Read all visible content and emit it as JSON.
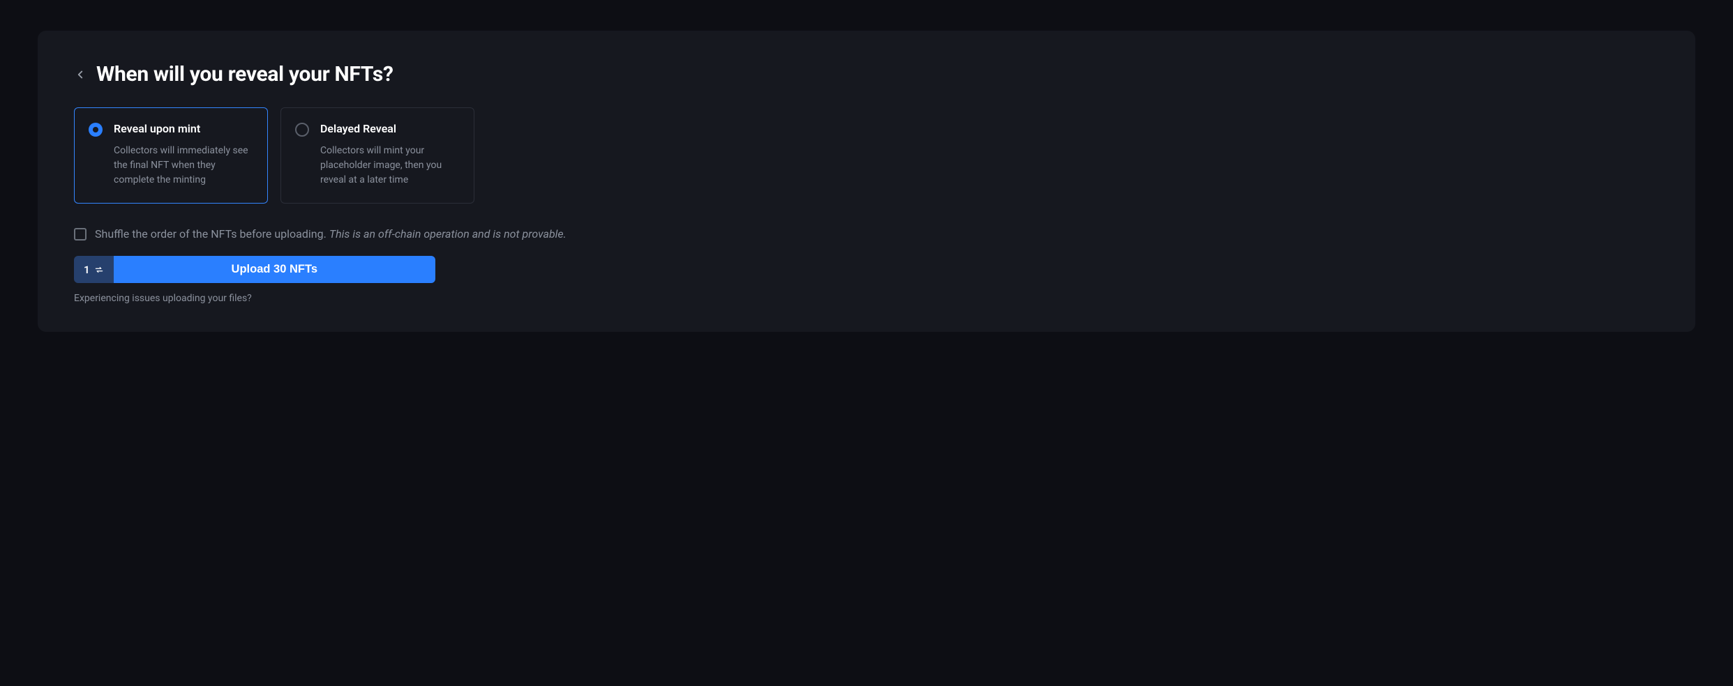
{
  "header": {
    "title": "When will you reveal your NFTs?"
  },
  "options": {
    "reveal_upon_mint": {
      "title": "Reveal upon mint",
      "description": "Collectors will immediately see the final NFT when they complete the minting"
    },
    "delayed_reveal": {
      "title": "Delayed Reveal",
      "description": "Collectors will mint your placeholder image, then you reveal at a later time"
    }
  },
  "shuffle": {
    "label": "Shuffle the order of the NFTs before uploading. ",
    "note": "This is an off-chain operation and is not provable."
  },
  "upload": {
    "count": "1",
    "button_label": "Upload 30 NFTs"
  },
  "helper": {
    "text": "Experiencing issues uploading your files?"
  }
}
